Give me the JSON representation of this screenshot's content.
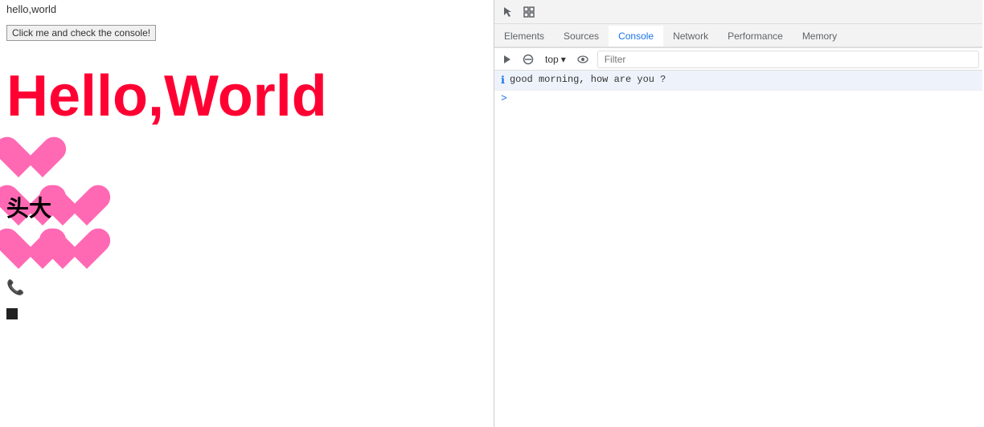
{
  "webpage": {
    "title": "hello,world",
    "button_label": "Click me and check the console!",
    "heading": "Hello,World",
    "chinese_text": "头大",
    "heart_rows": [
      {
        "count": 1,
        "type": "single"
      },
      {
        "count": 2,
        "type": "with-chinese"
      },
      {
        "count": 3,
        "type": "row"
      }
    ]
  },
  "devtools": {
    "tabs": [
      {
        "label": "Elements",
        "active": false
      },
      {
        "label": "Sources",
        "active": false
      },
      {
        "label": "Console",
        "active": true
      },
      {
        "label": "Network",
        "active": false
      },
      {
        "label": "Performance",
        "active": false
      },
      {
        "label": "Memory",
        "active": false
      }
    ],
    "top_dropdown": "top",
    "filter_placeholder": "Filter",
    "console_messages": [
      {
        "type": "info",
        "icon": "ℹ",
        "text": "good morning, how are you ?"
      }
    ],
    "prompt_symbol": ">"
  },
  "icons": {
    "cursor_icon": "⬡",
    "inspect_icon": "□",
    "play_icon": "▶",
    "no_entry_icon": "⊘",
    "eye_icon": "👁",
    "chevron_down": "▾"
  }
}
